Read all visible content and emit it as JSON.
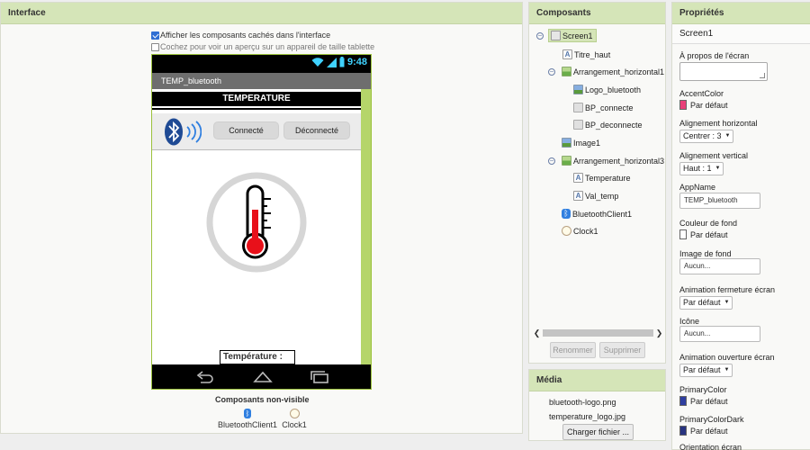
{
  "interface": {
    "title": "Interface",
    "show_hidden_label": "Afficher les composants cachés dans l'interface",
    "tablet_preview_label": "Cochez pour voir un aperçu sur un appareil de taille tablette",
    "phone": {
      "status_time": "9:48",
      "app_title": "TEMP_bluetooth",
      "header_text": "TEMPERATURE",
      "btn_connect": "Connecté",
      "btn_disconnect": "Déconnecté",
      "temp_label": "Température :"
    },
    "nonvisible_title": "Composants non-visible",
    "nonvisible": [
      {
        "label": "BluetoothClient1",
        "icon": "bluetooth-icon"
      },
      {
        "label": "Clock1",
        "icon": "clock-icon"
      }
    ]
  },
  "components": {
    "title": "Composants",
    "tree": [
      {
        "label": "Screen1",
        "icon": "screen-icon"
      },
      {
        "label": "Titre_haut",
        "icon": "label-icon"
      },
      {
        "label": "Arrangement_horizontal1",
        "icon": "arrangement-icon"
      },
      {
        "label": "Logo_bluetooth",
        "icon": "image-icon"
      },
      {
        "label": "BP_connecte",
        "icon": "button-icon"
      },
      {
        "label": "BP_deconnecte",
        "icon": "button-icon"
      },
      {
        "label": "Image1",
        "icon": "image-icon"
      },
      {
        "label": "Arrangement_horizontal3",
        "icon": "arrangement-icon"
      },
      {
        "label": "Temperature",
        "icon": "label-icon"
      },
      {
        "label": "Val_temp",
        "icon": "label-icon"
      },
      {
        "label": "BluetoothClient1",
        "icon": "bluetooth-icon"
      },
      {
        "label": "Clock1",
        "icon": "clock-icon"
      }
    ],
    "rename_label": "Renommer",
    "delete_label": "Supprimer"
  },
  "media": {
    "title": "Média",
    "files": [
      "bluetooth-logo.png",
      "temperature_logo.jpg"
    ],
    "upload_label": "Charger fichier ..."
  },
  "properties": {
    "title": "Propriétés",
    "component": "Screen1",
    "about_label": "À propos de l'écran",
    "accent_label": "AccentColor",
    "accent_value": "Par défaut",
    "accent_color": "#e8407a",
    "halign_label": "Alignement horizontal",
    "halign_value": "Centrer : 3",
    "valign_label": "Alignement vertical",
    "valign_value": "Haut : 1",
    "appname_label": "AppName",
    "appname_value": "TEMP_bluetooth",
    "bg_color_label": "Couleur de fond",
    "bg_color_value": "Par défaut",
    "bg_image_label": "Image de fond",
    "bg_image_value": "Aucun...",
    "close_anim_label": "Animation fermeture écran",
    "close_anim_value": "Par défaut",
    "icon_label": "Icône",
    "icon_value": "Aucun...",
    "open_anim_label": "Animation ouverture écran",
    "open_anim_value": "Par défaut",
    "primary_label": "PrimaryColor",
    "primary_value": "Par défaut",
    "primary_color": "#2f3fa0",
    "primary_dark_label": "PrimaryColorDark",
    "primary_dark_value": "Par défaut",
    "primary_dark_color": "#283480",
    "orientation_label": "Orientation écran"
  }
}
